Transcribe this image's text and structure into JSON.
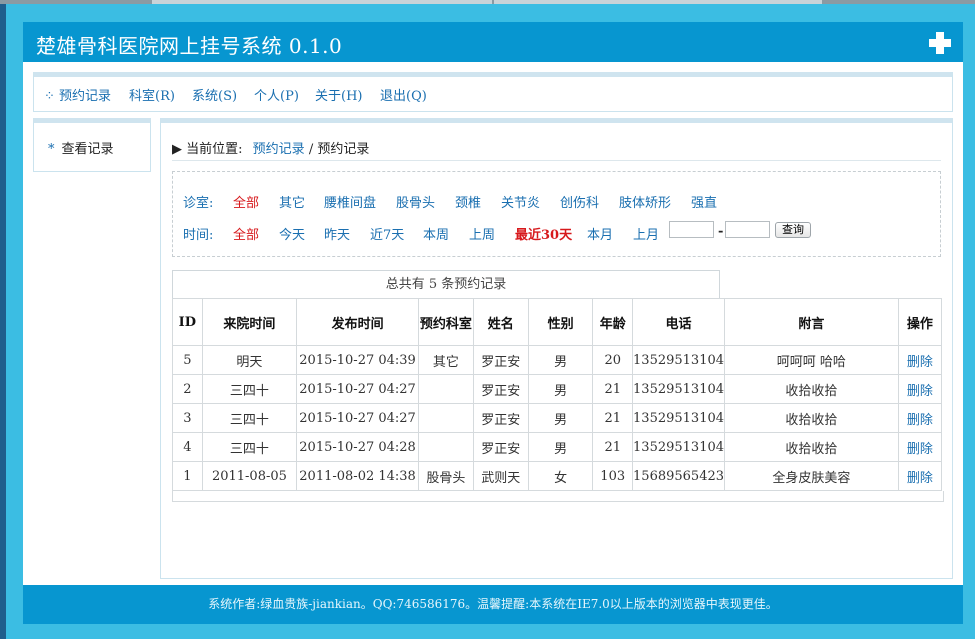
{
  "app": {
    "title": "楚雄骨科医院网上挂号系统 0.1.0"
  },
  "menu": [
    {
      "label": "⁘ 预约记录"
    },
    {
      "label": "科室(R)"
    },
    {
      "label": "系统(S)"
    },
    {
      "label": "个人(P)"
    },
    {
      "label": "关于(H)"
    },
    {
      "label": "退出(Q)"
    }
  ],
  "sidebar": {
    "star": "*",
    "item": "查看记录"
  },
  "breadcrumb": {
    "prefix": "▶ 当前位置:",
    "link": "预约记录",
    "sep": "/",
    "current": "预约记录"
  },
  "filters": {
    "dept_label": "诊室:",
    "dept_options": [
      "全部",
      "其它",
      "腰椎间盘",
      "股骨头",
      "颈椎",
      "关节炎",
      "创伤科",
      "肢体矫形",
      "强直"
    ],
    "time_label": "时间:",
    "time_options": [
      "全部",
      "今天",
      "昨天",
      "近7天",
      "本周",
      "上周",
      "最近30天",
      "本月",
      "上月"
    ],
    "date_sep": "-",
    "query_label": "查询"
  },
  "table": {
    "caption": "总共有 5 条预约记录",
    "columns": [
      "ID",
      "来院时间",
      "发布时间",
      "预约科室",
      "姓名",
      "性别",
      "年龄",
      "电话",
      "附言",
      "操作"
    ],
    "rows": [
      [
        "5",
        "明天",
        "2015-10-27 04:39",
        "其它",
        "罗正安",
        "男",
        "20",
        "13529513104",
        "呵呵呵 哈哈",
        "删除"
      ],
      [
        "2",
        "三四十",
        "2015-10-27 04:27",
        "",
        "罗正安",
        "男",
        "21",
        "13529513104",
        "收拾收拾",
        "删除"
      ],
      [
        "3",
        "三四十",
        "2015-10-27 04:27",
        "",
        "罗正安",
        "男",
        "21",
        "13529513104",
        "收拾收拾",
        "删除"
      ],
      [
        "4",
        "三四十",
        "2015-10-27 04:28",
        "",
        "罗正安",
        "男",
        "21",
        "13529513104",
        "收拾收拾",
        "删除"
      ],
      [
        "1",
        "2011-08-05",
        "2011-08-02 14:38",
        "股骨头",
        "武则天",
        "女",
        "103",
        "15689565423",
        "全身皮肤美容",
        "删除"
      ]
    ]
  },
  "footer": {
    "text": "系统作者:绿血贵族-jiankian。QQ:746586176。温馨提醒:本系统在IE7.0以上版本的浏览器中表现更佳。"
  },
  "colors": {
    "brand": "#0796d0",
    "link": "#1a6fb0",
    "selected": "#d7191c",
    "background": "#3bbde3"
  }
}
